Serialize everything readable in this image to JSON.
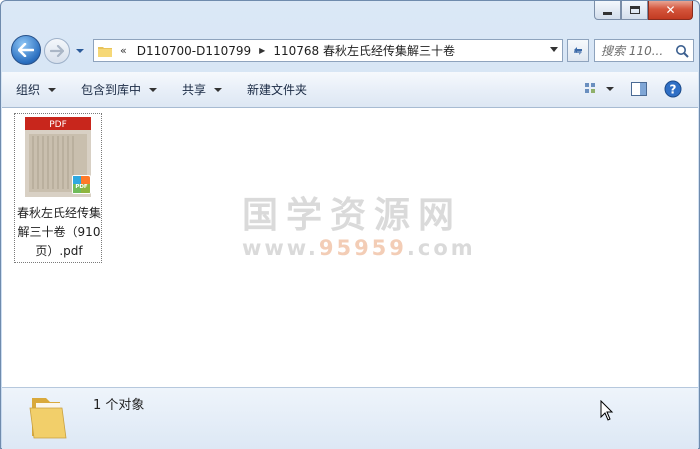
{
  "window": {
    "buttons": {
      "minimize": "minimize",
      "maximize": "maximize",
      "close": "✕"
    }
  },
  "nav": {
    "address": {
      "overflow": "«",
      "segments": [
        "D110700-D110799",
        "110768 春秋左氏经传集解三十卷"
      ]
    },
    "search": {
      "placeholder": "搜索 110..."
    }
  },
  "toolbar": {
    "items": [
      {
        "label": "组织",
        "has_menu": true
      },
      {
        "label": "包含到库中",
        "has_menu": true
      },
      {
        "label": "共享",
        "has_menu": true
      },
      {
        "label": "新建文件夹",
        "has_menu": false
      }
    ],
    "right_icons": [
      "view-options-icon",
      "preview-pane-icon",
      "help-icon"
    ]
  },
  "content": {
    "files": [
      {
        "name": "春秋左氏经传集解三十卷（910页）.pdf",
        "thumbnail_banner": "PDF",
        "badge": "PDF",
        "selected": true
      }
    ],
    "watermark": {
      "title": "国学资源网",
      "url_prefix": "www.",
      "url_highlight": "95959",
      "url_suffix": ".com"
    }
  },
  "status": {
    "text": "1 个对象"
  },
  "colors": {
    "chrome": "#dbe8f6",
    "close_button": "#c23b22",
    "pdf_banner": "#c8261c"
  }
}
